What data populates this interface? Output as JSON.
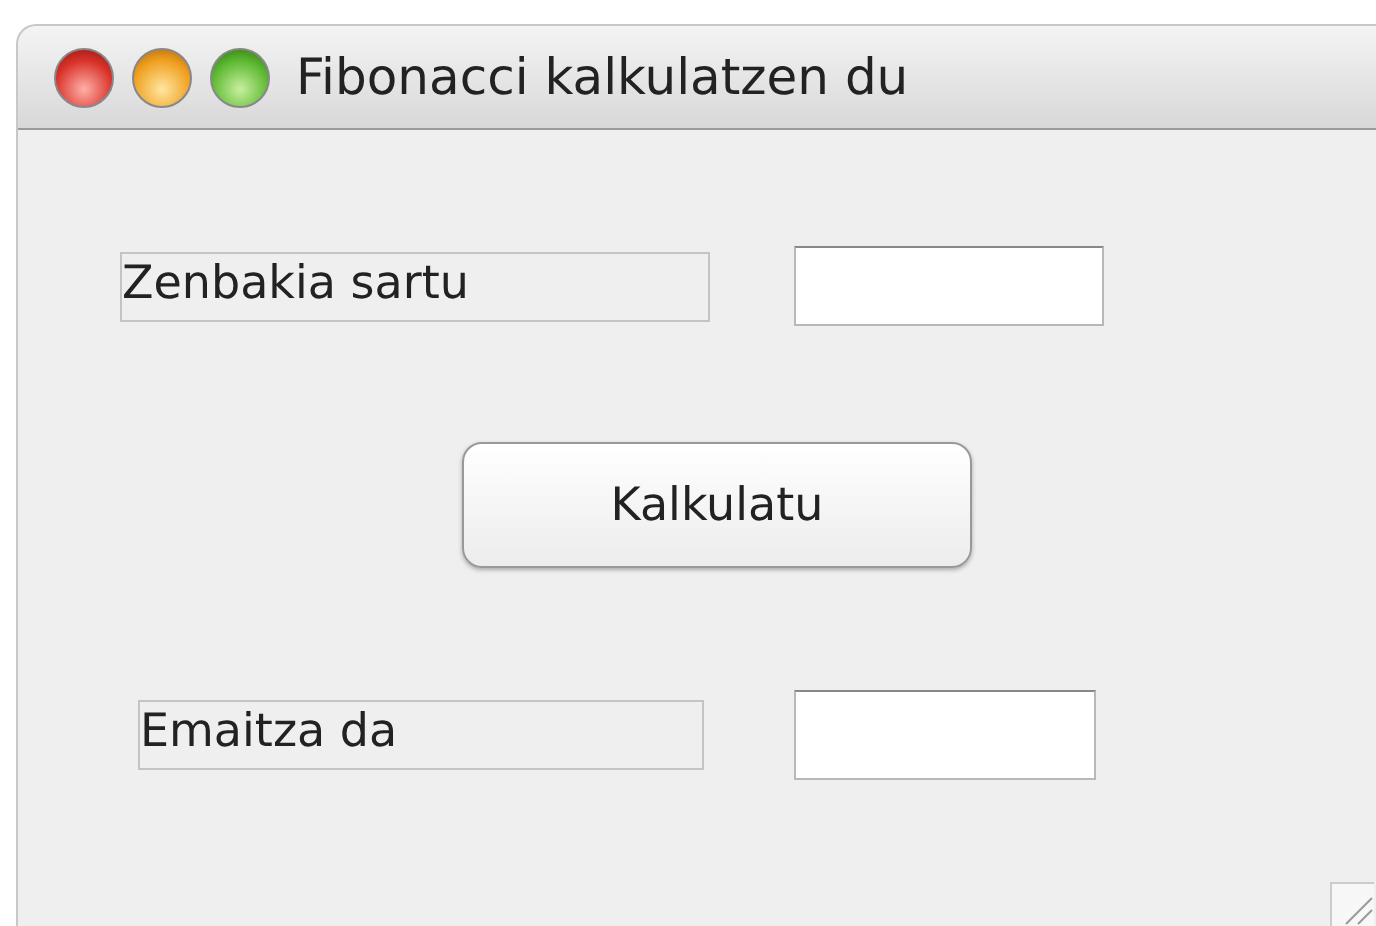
{
  "window": {
    "title": "Fibonacci kalkulatzen du"
  },
  "form": {
    "input_label": "Zenbakia sartu",
    "button": "Kalkulatu",
    "result_label": "Emaitza da"
  }
}
